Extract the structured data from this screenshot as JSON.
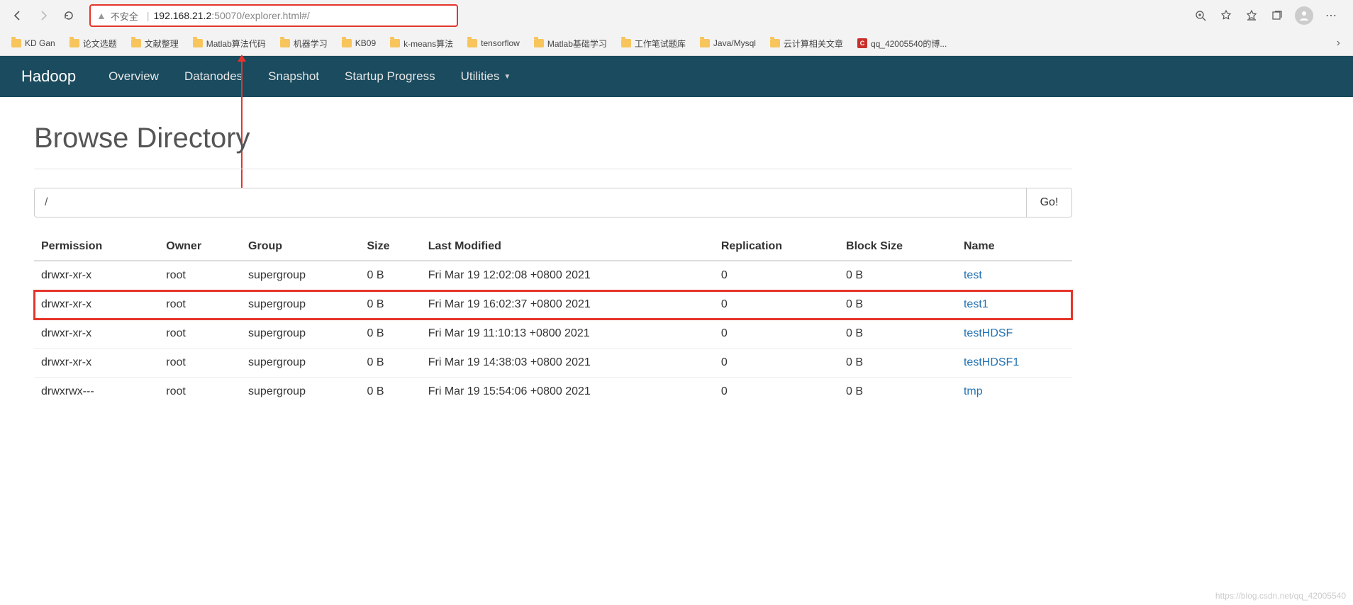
{
  "browser": {
    "insecure_label": "不安全",
    "url_host": "192.168.21.2",
    "url_port_path": ":50070/explorer.html#/",
    "bookmarks": [
      {
        "label": "KD Gan",
        "type": "folder"
      },
      {
        "label": "论文选题",
        "type": "folder"
      },
      {
        "label": "文献整理",
        "type": "folder"
      },
      {
        "label": "Matlab算法代码",
        "type": "folder"
      },
      {
        "label": "机器学习",
        "type": "folder"
      },
      {
        "label": "KB09",
        "type": "folder"
      },
      {
        "label": "k-means算法",
        "type": "folder"
      },
      {
        "label": "tensorflow",
        "type": "folder"
      },
      {
        "label": "Matlab基础学习",
        "type": "folder"
      },
      {
        "label": "工作笔试题库",
        "type": "folder"
      },
      {
        "label": "Java/Mysql",
        "type": "folder"
      },
      {
        "label": "云计算相关文章",
        "type": "folder"
      },
      {
        "label": "qq_42005540的博...",
        "type": "csdn"
      }
    ]
  },
  "nav": {
    "brand": "Hadoop",
    "items": [
      "Overview",
      "Datanodes",
      "Snapshot",
      "Startup Progress",
      "Utilities"
    ]
  },
  "page": {
    "title": "Browse Directory",
    "path_value": "/",
    "go_label": "Go!",
    "headers": [
      "Permission",
      "Owner",
      "Group",
      "Size",
      "Last Modified",
      "Replication",
      "Block Size",
      "Name"
    ],
    "rows": [
      {
        "perm": "drwxr-xr-x",
        "owner": "root",
        "group": "supergroup",
        "size": "0 B",
        "modified": "Fri Mar 19 12:02:08 +0800 2021",
        "repl": "0",
        "block": "0 B",
        "name": "test",
        "hl": false
      },
      {
        "perm": "drwxr-xr-x",
        "owner": "root",
        "group": "supergroup",
        "size": "0 B",
        "modified": "Fri Mar 19 16:02:37 +0800 2021",
        "repl": "0",
        "block": "0 B",
        "name": "test1",
        "hl": true
      },
      {
        "perm": "drwxr-xr-x",
        "owner": "root",
        "group": "supergroup",
        "size": "0 B",
        "modified": "Fri Mar 19 11:10:13 +0800 2021",
        "repl": "0",
        "block": "0 B",
        "name": "testHDSF",
        "hl": false
      },
      {
        "perm": "drwxr-xr-x",
        "owner": "root",
        "group": "supergroup",
        "size": "0 B",
        "modified": "Fri Mar 19 14:38:03 +0800 2021",
        "repl": "0",
        "block": "0 B",
        "name": "testHDSF1",
        "hl": false
      },
      {
        "perm": "drwxrwx---",
        "owner": "root",
        "group": "supergroup",
        "size": "0 B",
        "modified": "Fri Mar 19 15:54:06 +0800 2021",
        "repl": "0",
        "block": "0 B",
        "name": "tmp",
        "hl": false
      }
    ]
  },
  "watermark": "https://blog.csdn.net/qq_42005540"
}
